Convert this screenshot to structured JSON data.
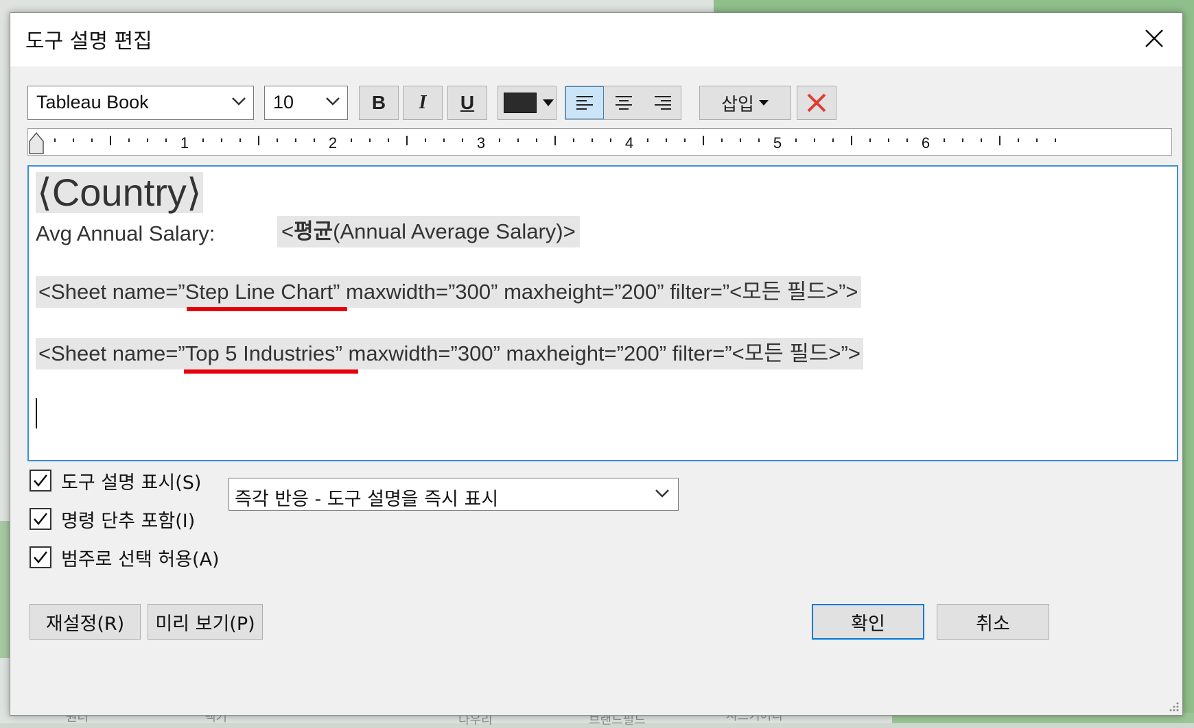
{
  "background": {
    "map_labels": [
      "원터",
      "백기",
      "다우리",
      "브랜드필드",
      "시드키어리"
    ]
  },
  "dialog": {
    "title": "도구 설명 편집",
    "close_icon": "close-icon"
  },
  "toolbar": {
    "font_family": "Tableau Book",
    "font_size": "10",
    "bold_label": "B",
    "italic_label": "I",
    "underline_label": "U",
    "font_color": "#2b2b2b",
    "insert_label": "삽입",
    "align_left_active": true
  },
  "ruler": {
    "labels": [
      "1",
      "2",
      "3",
      "4",
      "5",
      "6"
    ]
  },
  "editor": {
    "country_field": "⟨Country⟩",
    "salary_label": "Avg Annual Salary:",
    "salary_field_prefix": "<",
    "salary_field_bold": "평균",
    "salary_field_suffix": "(Annual Average Salary)>",
    "sheet1": {
      "prefix": "<Sheet name=”",
      "name": "Step Line Chart",
      "suffix": "” maxwidth=”300” maxheight=”200” filter=”<모든 필드>”>"
    },
    "sheet2": {
      "prefix": "<Sheet name=”",
      "name": "Top 5 Industries",
      "suffix": "” maxwidth=”300” maxheight=”200” filter=”<모든 필드>”>"
    }
  },
  "options": {
    "show_tooltip_label": "도구 설명 표시(S)",
    "show_tooltip_checked": true,
    "tooltip_mode": "즉각 반응 - 도구 설명을 즉시 표시",
    "include_command_buttons_label": "명령 단추 포함(I)",
    "include_command_buttons_checked": true,
    "allow_legend_selection_label": "범주로 선택 허용(A)",
    "allow_legend_selection_checked": true
  },
  "buttons": {
    "reset": "재설정(R)",
    "preview": "미리 보기(P)",
    "ok": "확인",
    "cancel": "취소"
  },
  "colors": {
    "annotation_red": "#e8000b",
    "focus_blue": "#3c8fd8"
  }
}
